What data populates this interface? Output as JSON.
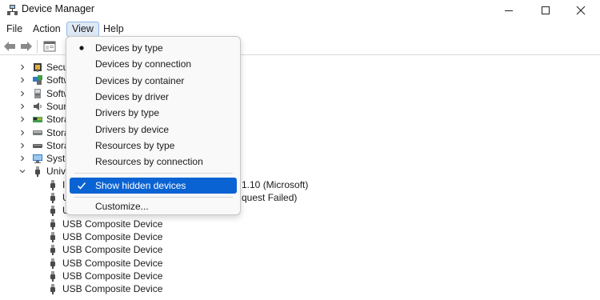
{
  "window": {
    "title": "Device Manager"
  },
  "menubar": {
    "file": "File",
    "action": "Action",
    "view": "View",
    "help": "Help"
  },
  "view_menu": {
    "items": [
      {
        "label": "Devices by type",
        "mark": "bullet"
      },
      {
        "label": "Devices by connection",
        "mark": ""
      },
      {
        "label": "Devices by container",
        "mark": ""
      },
      {
        "label": "Devices by driver",
        "mark": ""
      },
      {
        "label": "Drivers by type",
        "mark": ""
      },
      {
        "label": "Drivers by device",
        "mark": ""
      },
      {
        "label": "Resources by type",
        "mark": ""
      },
      {
        "label": "Resources by connection",
        "mark": ""
      }
    ],
    "show_hidden": {
      "label": "Show hidden devices",
      "mark": "check"
    },
    "customize": {
      "label": "Customize..."
    }
  },
  "tree": {
    "categories": [
      {
        "label": "Secu",
        "icon": "security-device-icon"
      },
      {
        "label": "Softw",
        "icon": "software-component-icon"
      },
      {
        "label": "Softw",
        "icon": "software-device-icon"
      },
      {
        "label": "Soun",
        "icon": "sound-icon"
      },
      {
        "label": "Stora",
        "icon": "storage-controller-icon"
      },
      {
        "label": "Stora",
        "icon": "storage-volume-icon"
      },
      {
        "label": "Stora",
        "icon": "storage-drive-icon"
      },
      {
        "label": "Syste",
        "icon": "system-device-icon"
      },
      {
        "label": "Unive",
        "icon": "usb-icon"
      }
    ],
    "usb_children": [
      {
        "label": "1.10 (Microsoft)"
      },
      {
        "label": "quest Failed)"
      },
      {
        "label": ""
      },
      {
        "label": "USB Composite Device"
      },
      {
        "label": "USB Composite Device"
      },
      {
        "label": "USB Composite Device"
      },
      {
        "label": "USB Composite Device"
      },
      {
        "label": "USB Composite Device"
      },
      {
        "label": "USB Composite Device"
      }
    ],
    "partial_prefixes": {
      "row1": "I",
      "row2": "U",
      "row3": "U"
    }
  },
  "colors": {
    "highlight": "#0a63d3",
    "view_menu_bg": "#dfe9f5",
    "menu_bg": "#f9f9f9"
  }
}
